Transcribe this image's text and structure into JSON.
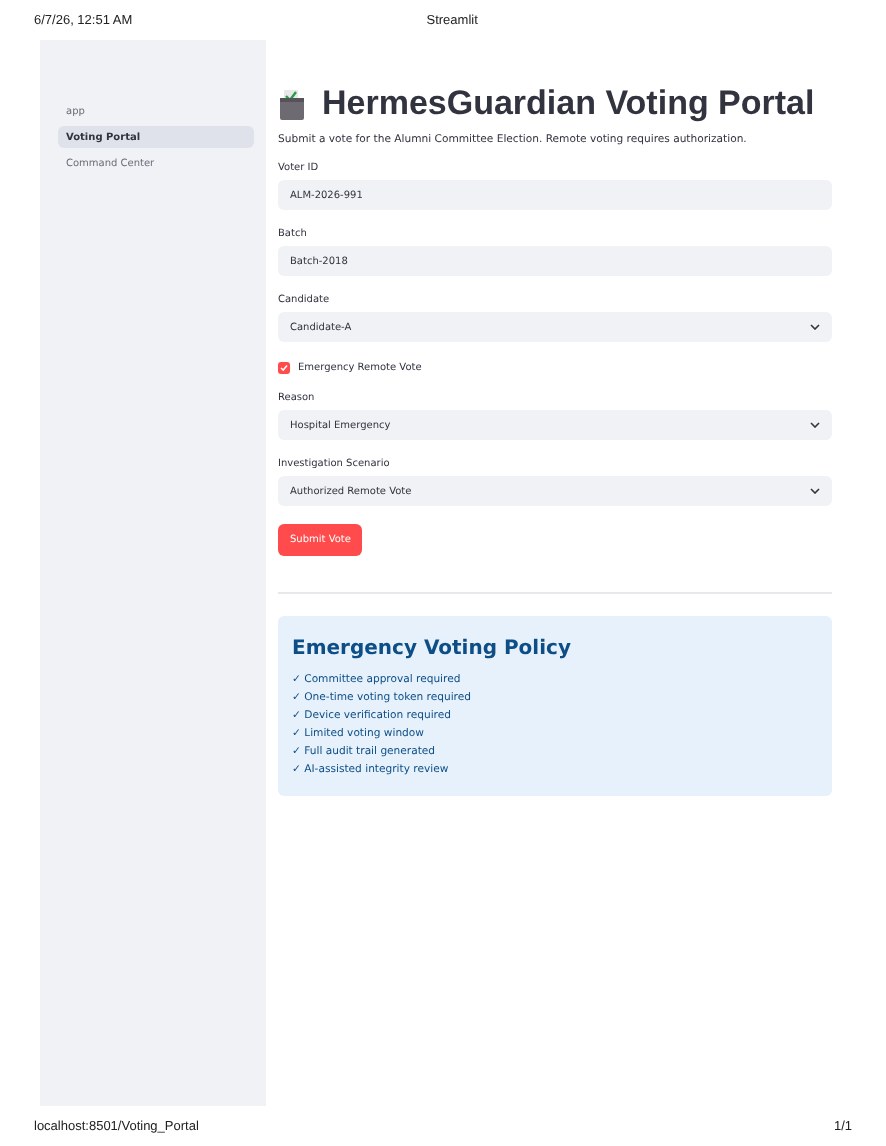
{
  "print_header": {
    "date": "6/7/26, 12:51 AM",
    "title": "Streamlit"
  },
  "sidebar": {
    "items": [
      {
        "label": "app",
        "selected": false
      },
      {
        "label": "Voting Portal",
        "selected": true
      },
      {
        "label": "Command Center",
        "selected": false
      }
    ]
  },
  "main": {
    "title": "HermesGuardian Voting Portal",
    "subtitle": "Submit a vote for the Alumni Committee Election. Remote voting requires authorization.",
    "widgets": [
      {
        "kind": "text",
        "label": "Voter ID",
        "value": "ALM-2026-991"
      },
      {
        "kind": "text",
        "label": "Batch",
        "value": "Batch-2018"
      },
      {
        "kind": "select",
        "label": "Candidate",
        "value": "Candidate-A"
      },
      {
        "kind": "checkbox",
        "label": "Emergency Remote Vote",
        "checked": true
      },
      {
        "kind": "select",
        "label": "Reason",
        "value": "Hospital Emergency"
      },
      {
        "kind": "select",
        "label": "Investigation Scenario",
        "value": "Authorized Remote Vote"
      }
    ],
    "button": "Submit Vote",
    "policy": {
      "title": "Emergency Voting Policy",
      "items": [
        "✓ Committee approval required",
        "✓ One-time voting token required",
        "✓ Device verification required",
        "✓ Limited voting window",
        "✓ Full audit trail generated",
        "✓ AI-assisted integrity review"
      ]
    }
  },
  "print_footer": {
    "url": "localhost:8501/Voting_Portal",
    "page": "1/1"
  }
}
